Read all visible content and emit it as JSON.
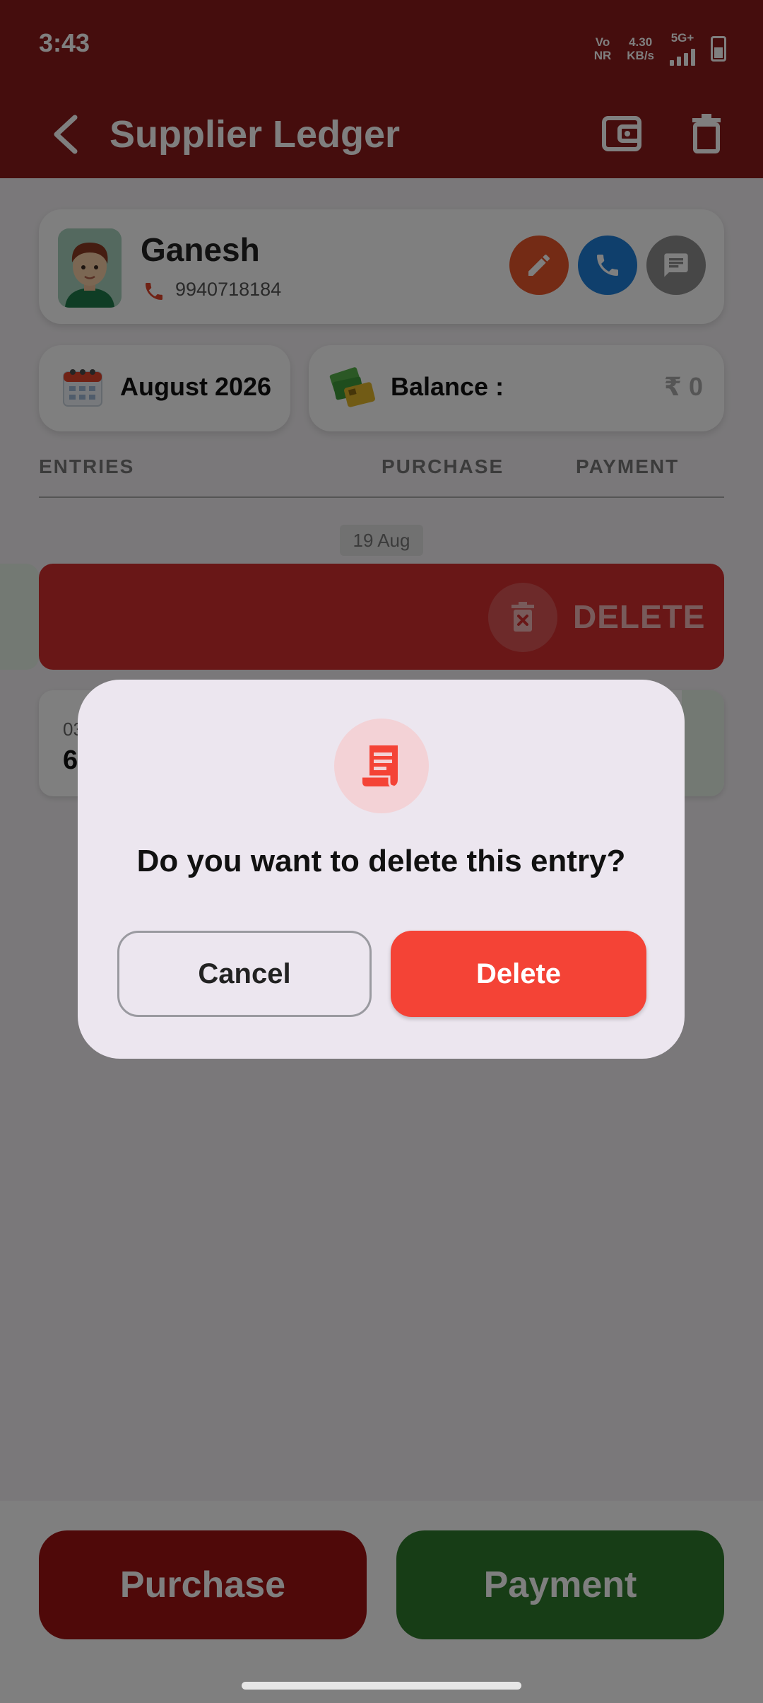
{
  "status_bar": {
    "time": "3:43",
    "network_vo": "Vo",
    "network_nr": "NR",
    "speed_value": "4.30",
    "speed_unit": "KB/s",
    "network_type": "5G+"
  },
  "app_bar": {
    "title": "Supplier Ledger"
  },
  "contact": {
    "name": "Ganesh",
    "phone": "9940718184"
  },
  "month": {
    "label": "August 2026"
  },
  "balance": {
    "label": "Balance :",
    "value": "₹ 0"
  },
  "columns": {
    "entries": "ENTRIES",
    "purchase": "PURCHASE",
    "payment": "PAYMENT"
  },
  "date_group": "19 Aug",
  "swipe_action": {
    "label": "DELETE"
  },
  "entry": {
    "date_partial": "03",
    "amount_partial": "6"
  },
  "bottom_bar": {
    "purchase_label": "Purchase",
    "payment_label": "Payment"
  },
  "dialog": {
    "message": "Do you want to delete this entry?",
    "cancel_label": "Cancel",
    "delete_label": "Delete"
  },
  "colors": {
    "primary": "#8b1a1a",
    "danger": "#f44336",
    "success": "#2f7a2c"
  }
}
